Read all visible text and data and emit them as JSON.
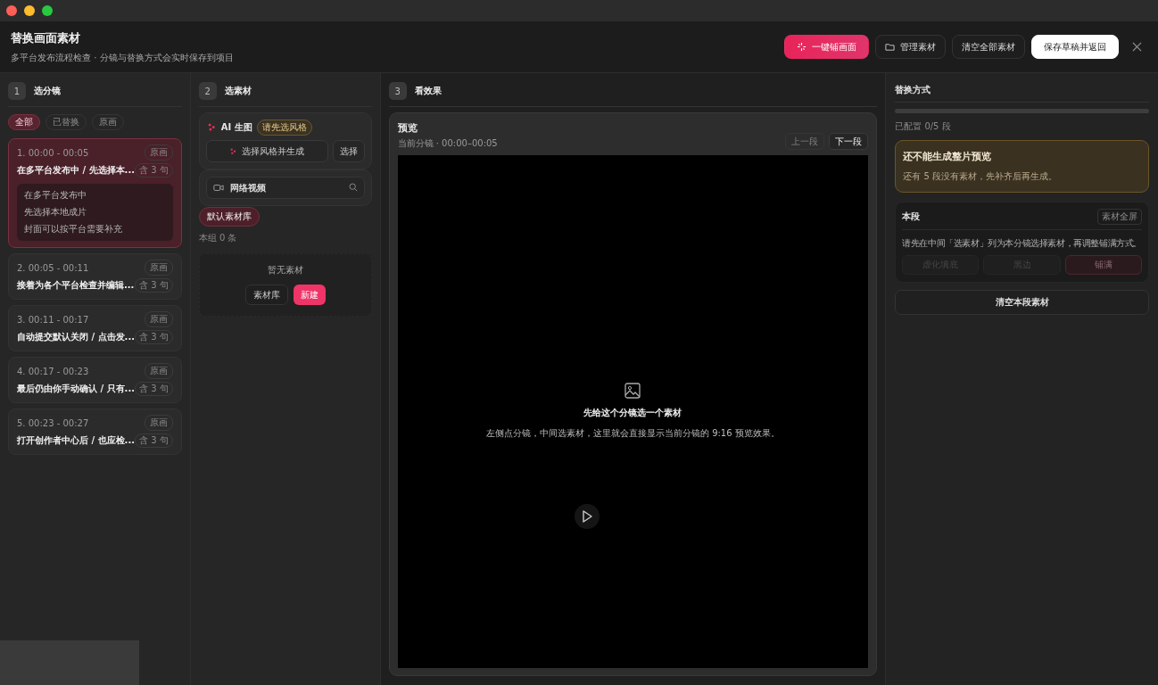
{
  "header": {
    "title": "替换画面素材",
    "subtitle": "多平台发布流程检查 · 分镜与替换方式会实时保存到项目",
    "actions": [
      {
        "label": "一键铺画面",
        "kind": "primary"
      },
      {
        "label": "管理素材",
        "kind": "outline"
      },
      {
        "label": "清空全部素材",
        "kind": "outline"
      },
      {
        "label": "保存草稿并返回",
        "kind": "light"
      }
    ]
  },
  "shots_column": {
    "number": "1",
    "title": "选分镜",
    "filters": [
      {
        "label": "全部",
        "selected": true
      },
      {
        "label": "已替换",
        "selected": false
      },
      {
        "label": "原画",
        "selected": false
      }
    ],
    "shots": [
      {
        "time": "1. 00:00 - 00:05",
        "title": "在多平台发布中 / 先选择本...",
        "tag": "原画",
        "count": "含 3 句",
        "selected": true,
        "lines": [
          "在多平台发布中",
          "先选择本地成片",
          "封面可以按平台需要补充"
        ]
      },
      {
        "time": "2. 00:05 - 00:11",
        "title": "接着为各个平台检查并编辑...",
        "tag": "原画",
        "count": "含 3 句",
        "selected": false
      },
      {
        "time": "3. 00:11 - 00:17",
        "title": "自动提交默认关闭 / 点击发...",
        "tag": "原画",
        "count": "含 3 句",
        "selected": false
      },
      {
        "time": "4. 00:17 - 00:23",
        "title": "最后仍由你手动确认 / 只有...",
        "tag": "原画",
        "count": "含 3 句",
        "selected": false
      },
      {
        "time": "5. 00:23 - 00:27",
        "title": "打开创作者中心后 / 也应检...",
        "tag": "原画",
        "count": "含 3 句",
        "selected": false
      }
    ]
  },
  "assets_column": {
    "number": "2",
    "title": "选素材",
    "ai": {
      "title": "AI 生图",
      "badge": "请先选风格",
      "generate": "选择风格并生成",
      "select": "选择"
    },
    "search": {
      "placeholder": "网络视频"
    },
    "library_tabs": [
      {
        "label": "默认素材库",
        "selected": true
      }
    ],
    "count": "本组 0 条",
    "empty": {
      "text": "暂无素材",
      "buttons": [
        {
          "label": "素材库",
          "kind": "outline"
        },
        {
          "label": "新建",
          "kind": "primary"
        }
      ]
    }
  },
  "preview_column": {
    "number": "3",
    "title": "看效果",
    "preview": {
      "title": "预览",
      "subtitle": "当前分镜 · 00:00–00:05",
      "buttons": [
        {
          "label": "上一段",
          "disabled": true
        },
        {
          "label": "下一段",
          "disabled": false
        }
      ],
      "empty_title": "先给这个分镜选一个素材",
      "empty_text": "左侧点分镜，中间选素材，这里就会直接显示当前分镜的 9:16 预览效果。"
    }
  },
  "method_panel": {
    "title": "替换方式",
    "progress": {
      "level": 0
    },
    "progress_text": "已配置 0/5 段",
    "warning": {
      "title": "还不能生成整片预览",
      "text": "还有 5 段没有素材，先补齐后再生成。"
    },
    "segment": {
      "title": "本段",
      "badge": "素材全屏",
      "hint": "请先在中间「选素材」列为本分镜选择素材，再调整铺满方式。",
      "modes": [
        {
          "label": "虚化填底",
          "selected": false,
          "disabled": true
        },
        {
          "label": "黑边",
          "selected": false,
          "disabled": true
        },
        {
          "label": "铺满",
          "selected": true,
          "disabled": true
        }
      ]
    },
    "clear_button": "清空本段素材"
  }
}
